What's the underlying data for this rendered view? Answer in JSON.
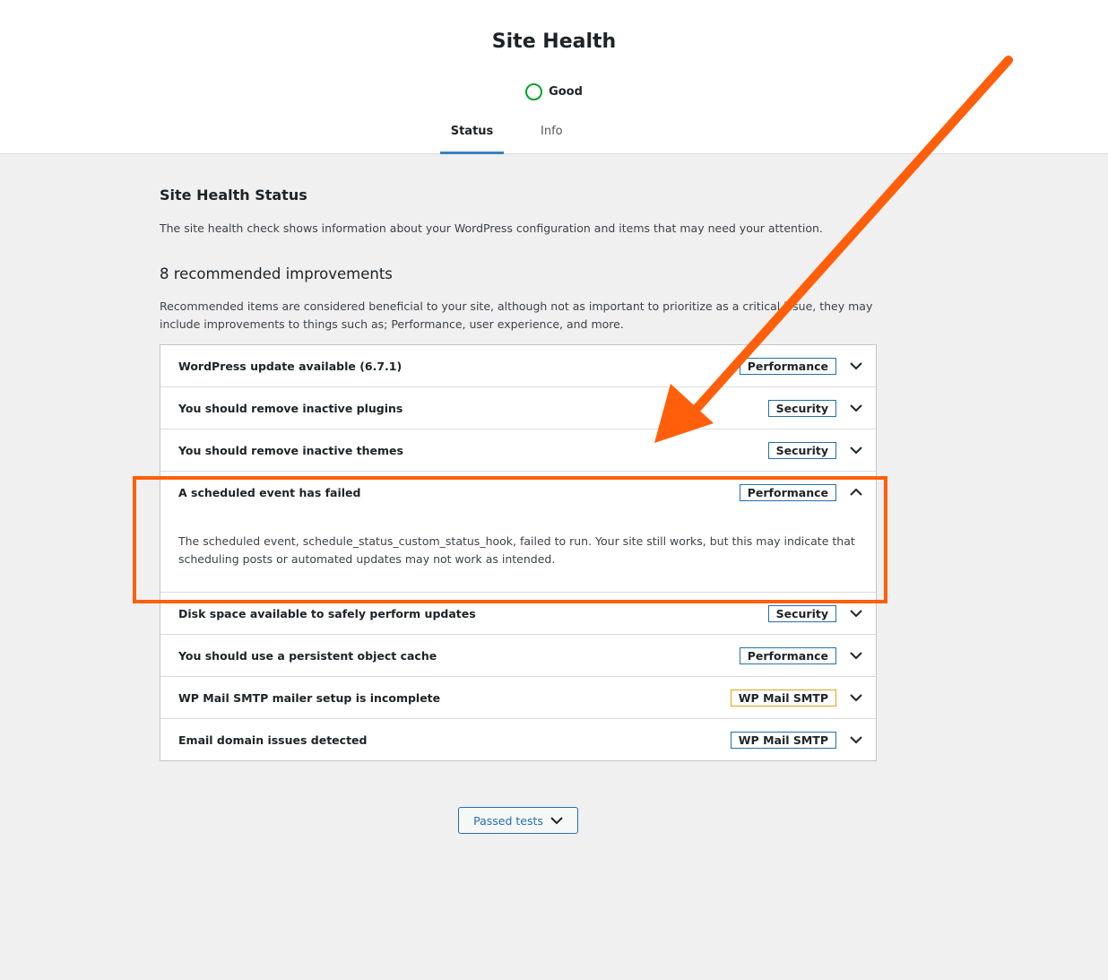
{
  "header": {
    "title": "Site Health",
    "status_label": "Good",
    "tabs": [
      {
        "label": "Status",
        "active": true
      },
      {
        "label": "Info",
        "active": false
      }
    ]
  },
  "main": {
    "section_title": "Site Health Status",
    "section_desc": "The site health check shows information about your WordPress configuration and items that may need your attention.",
    "improve_title": "8 recommended improvements",
    "improve_desc": "Recommended items are considered beneficial to your site, although not as important to prioritize as a critical issue, they may include improvements to things such as; Performance, user experience, and more."
  },
  "items": [
    {
      "title": "WordPress update available (6.7.1)",
      "badge": "Performance",
      "expanded": false
    },
    {
      "title": "You should remove inactive plugins",
      "badge": "Security",
      "expanded": false
    },
    {
      "title": "You should remove inactive themes",
      "badge": "Security",
      "expanded": false
    },
    {
      "title": "A scheduled event has failed",
      "badge": "Performance",
      "expanded": true,
      "description": "The scheduled event, schedule_status_custom_status_hook, failed to run. Your site still works, but this may indicate that scheduling posts or automated updates may not work as intended."
    },
    {
      "title": "Disk space available to safely perform updates",
      "badge": "Security",
      "expanded": false
    },
    {
      "title": "You should use a persistent object cache",
      "badge": "Performance",
      "expanded": false
    },
    {
      "title": "WP Mail SMTP mailer setup is incomplete",
      "badge": "WP Mail SMTP",
      "expanded": false
    },
    {
      "title": "Email domain issues detected",
      "badge": "WP Mail SMTP",
      "expanded": false
    }
  ],
  "passed_button": {
    "label": "Passed tests"
  },
  "colors": {
    "accent": "#2271b1",
    "good": "#00a32a",
    "annotation": "#ff5f0a",
    "badge_warning": "#dba617"
  },
  "icons": {
    "status": "status-ring-icon",
    "chevron_down": "chevron-down-icon",
    "chevron_up": "chevron-up-icon"
  }
}
